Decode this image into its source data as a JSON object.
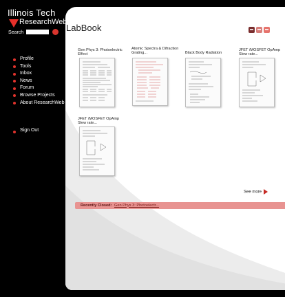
{
  "brand": {
    "line1": "Illinois Tech",
    "line2": "ResearchWeb"
  },
  "search": {
    "label": "Search",
    "placeholder": ""
  },
  "nav": {
    "items": [
      {
        "label": "Profile"
      },
      {
        "label": "Tools"
      },
      {
        "label": "Inbox"
      },
      {
        "label": "News"
      },
      {
        "label": "Forum"
      },
      {
        "label": "Browse Projects"
      },
      {
        "label": "About ResearchWeb"
      }
    ],
    "signout": "Sign Out"
  },
  "main": {
    "title": "LabBook",
    "notebooks": [
      {
        "title": "Gen Phys 3: Photoelectric Effect"
      },
      {
        "title": "Atomic Spectra & Difraction Grating..."
      },
      {
        "title": "Black Body Radiation"
      },
      {
        "title": "JFET /MOSFET OpAmp Slew rate..."
      },
      {
        "title": "JFET /MOSFET OpAmp Slew rate..."
      }
    ],
    "see_more": "See more",
    "recently_closed": {
      "label": "Recently Closed:",
      "link": "Gen Phys 3: Photoelectr..."
    }
  },
  "colors": {
    "accent_red": "#e0332c",
    "recent_bar": "#e89391",
    "sidebar_bg": "#000000",
    "panel_bg": "#ffffff"
  },
  "icons": {
    "logo": "red-triangle-icon",
    "search_go": "red-circle-go-icon",
    "nav_bullet": "red-dot-icon",
    "see_more": "red-arrow-right-icon"
  }
}
